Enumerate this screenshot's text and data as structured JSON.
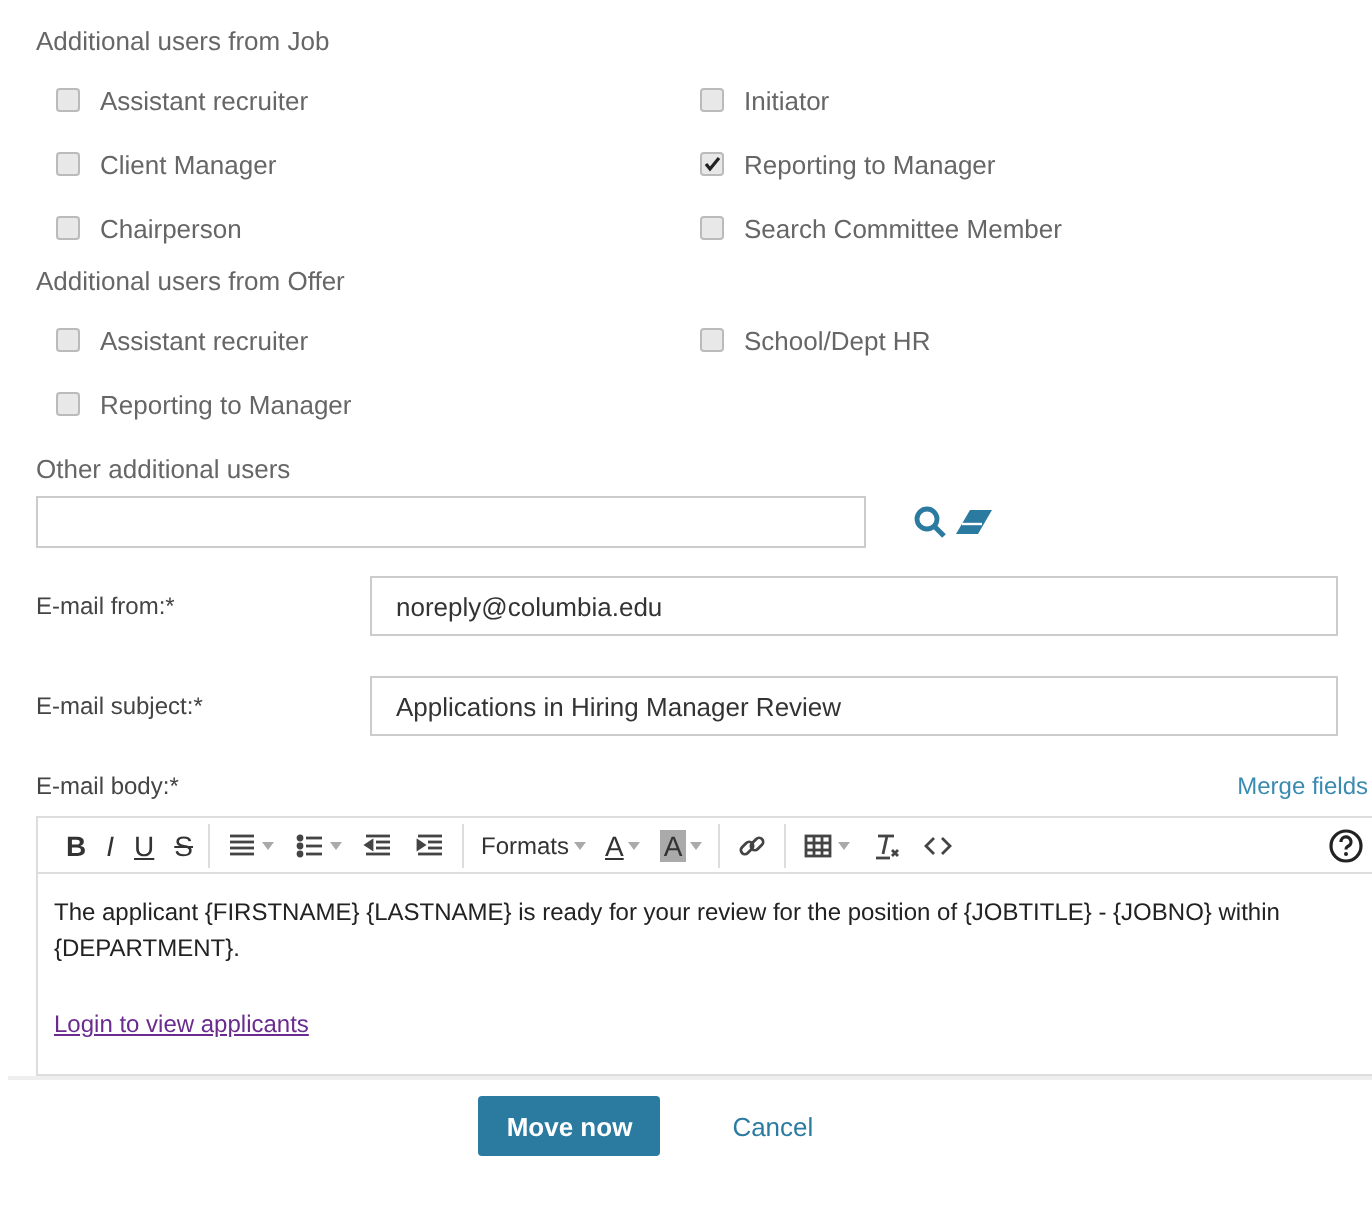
{
  "groups": [
    {
      "title": "Additional users from Job",
      "options": [
        {
          "label": "Assistant recruiter",
          "checked": false
        },
        {
          "label": "Initiator",
          "checked": false
        },
        {
          "label": "Client Manager",
          "checked": false
        },
        {
          "label": "Reporting to Manager",
          "checked": true
        },
        {
          "label": "Chairperson",
          "checked": false
        },
        {
          "label": "Search Committee Member",
          "checked": false
        }
      ]
    },
    {
      "title": "Additional users from Offer",
      "options": [
        {
          "label": "Assistant recruiter",
          "checked": false
        },
        {
          "label": "School/Dept HR",
          "checked": false
        },
        {
          "label": "Reporting to Manager",
          "checked": false
        }
      ]
    }
  ],
  "other_users": {
    "label": "Other additional users"
  },
  "fields": [
    {
      "label": "E-mail from:*",
      "value": "noreply@columbia.edu"
    },
    {
      "label": "E-mail subject:*",
      "value": "Applications in Hiring Manager Review"
    }
  ],
  "body": {
    "label": "E-mail body:*",
    "merge_link": "Merge fields",
    "toolbar": {
      "style_buttons": [
        "B",
        "I",
        "U",
        "S"
      ],
      "formats": "Formats",
      "text_color": "A",
      "background_color": "A"
    },
    "paragraph": "The applicant {FIRSTNAME} {LASTNAME} is ready for your review for the position of {JOBTITLE} - {JOBNO} within {DEPARTMENT}.",
    "link": "Login to view applicants"
  },
  "buttons": [
    {
      "label": "Move now",
      "kind": "primary"
    },
    {
      "label": "Cancel",
      "kind": "link"
    }
  ]
}
